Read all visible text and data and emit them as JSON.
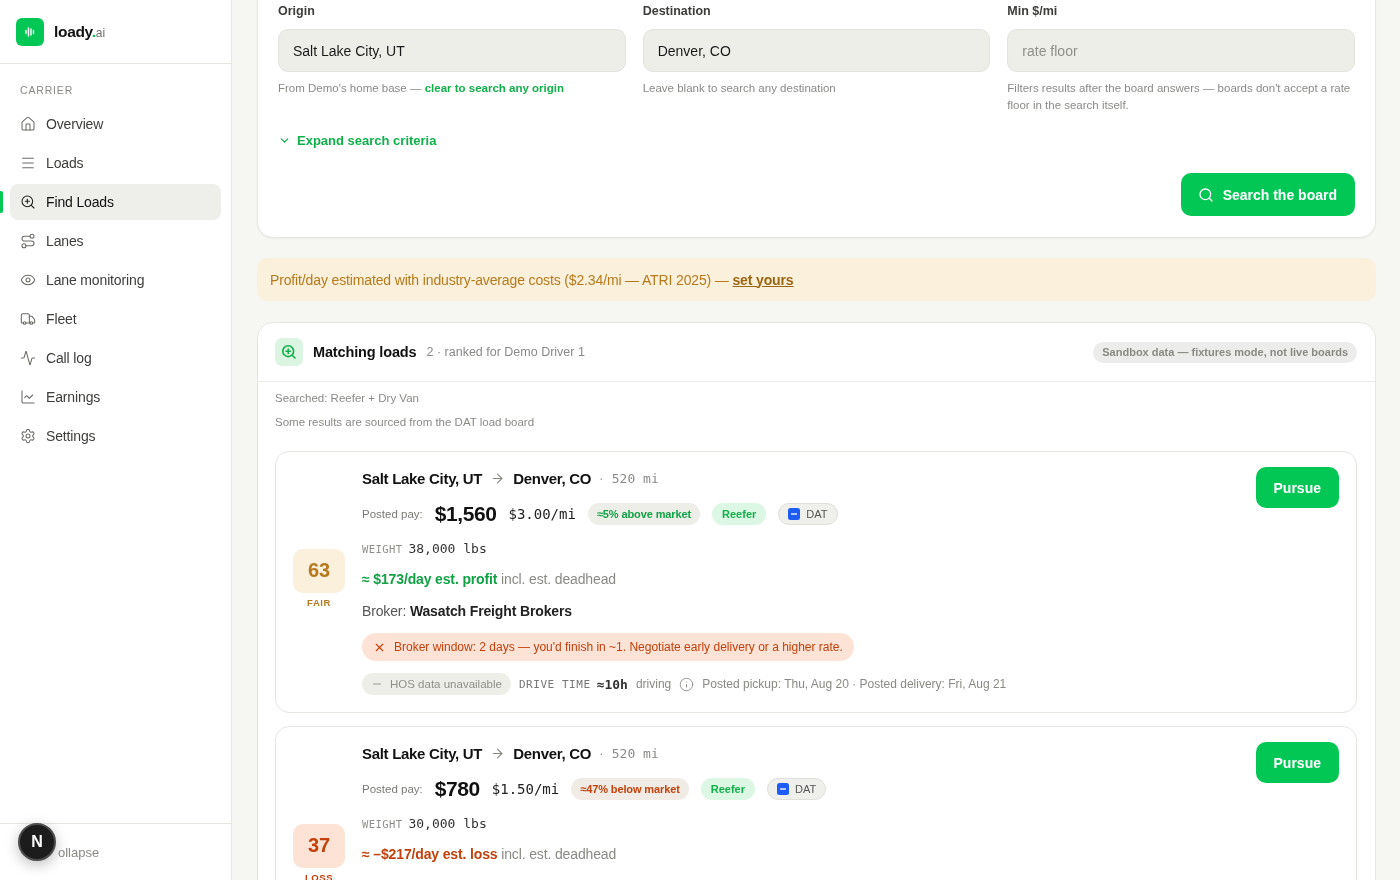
{
  "sidebar": {
    "brand": {
      "name": "loady",
      "dot": ".",
      "tld": "ai"
    },
    "section": "CARRIER",
    "items": [
      {
        "label": "Overview",
        "selected": false
      },
      {
        "label": "Loads",
        "selected": false
      },
      {
        "label": "Find Loads",
        "selected": true
      },
      {
        "label": "Lanes",
        "selected": false
      },
      {
        "label": "Lane monitoring",
        "selected": false
      },
      {
        "label": "Fleet",
        "selected": false
      },
      {
        "label": "Call log",
        "selected": false
      },
      {
        "label": "Earnings",
        "selected": false
      },
      {
        "label": "Settings",
        "selected": false
      }
    ],
    "collapse": "ollapse"
  },
  "overlay_badge": "N",
  "search_form": {
    "fields": [
      {
        "label": "Origin",
        "value": "Salt Lake City, UT",
        "help": "From Demo's home base —",
        "help_link": "clear to search any origin"
      },
      {
        "label": "Destination",
        "value": "Denver, CO",
        "help": "Leave blank to search any destination"
      },
      {
        "label": "Min $/mi",
        "placeholder": "rate floor",
        "help": "Filters results after the board answers — boards don't accept a rate floor in the search itself."
      }
    ],
    "expand": {
      "label": "Expand search criteria",
      "expanded": false
    },
    "submit": "Search the board"
  },
  "banner": {
    "text": "Profit/day estimated with industry-average costs ($2.34/mi — ATRI 2025) —",
    "link": "set yours"
  },
  "results": {
    "title": "Matching loads",
    "subtitle": "2 · ranked for Demo Driver 1",
    "badge": "Sandbox data — fixtures mode, not live boards",
    "notes": [
      "Searched: Reefer + Dry Van",
      "Some results are sourced from the DAT load board"
    ],
    "loads": [
      {
        "score": {
          "value": "63",
          "label": "FAIR",
          "kind": "fair"
        },
        "origin": "Salt Lake City, UT",
        "destination": "Denver, CO",
        "separator": "·",
        "distance": "520 mi",
        "pay_label": "Posted pay:",
        "pay": "$1,560",
        "rate": "$3.00/mi",
        "market": {
          "text": "≈5% above market",
          "kind": "above"
        },
        "equipment": "Reefer",
        "source": "DAT",
        "weight_label": "WEIGHT",
        "weight": "38,000 lbs",
        "estimate": {
          "text": "**≈ $173/day est. profit** incl. est. deadhead",
          "kind": "profit"
        },
        "broker": "Broker: **Wasatch Freight Brokers**",
        "alert": "Broker window: 2 days — you'd finish in ~1. Negotiate early delivery or a higher rate.",
        "hos": "HOS data unavailable",
        "drive_label": "DRIVE TIME",
        "drive_time": "≈10h",
        "drive_unit": "driving",
        "dates": "Posted pickup: Thu, Aug 20 · Posted delivery: Fri, Aug 21",
        "action": "Pursue"
      },
      {
        "score": {
          "value": "37",
          "label": "LOSS",
          "kind": "loss"
        },
        "origin": "Salt Lake City, UT",
        "destination": "Denver, CO",
        "separator": "·",
        "distance": "520 mi",
        "pay_label": "Posted pay:",
        "pay": "$780",
        "rate": "$1.50/mi",
        "market": {
          "text": "≈47% below market",
          "kind": "below"
        },
        "equipment": "Reefer",
        "source": "DAT",
        "weight_label": "WEIGHT",
        "weight": "30,000 lbs",
        "estimate": {
          "text": "**≈ –$217/day est. loss** incl. est. deadhead",
          "kind": "loss"
        },
        "action": "Pursue"
      }
    ]
  }
}
